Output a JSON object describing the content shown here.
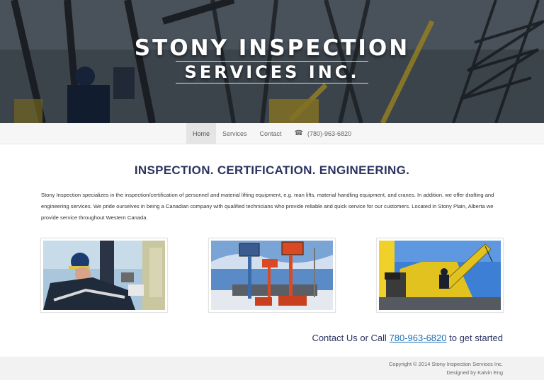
{
  "hero": {
    "title_line1": "STONY INSPECTION",
    "title_line2": "SERVICES INC."
  },
  "nav": {
    "items": [
      {
        "label": "Home",
        "active": true
      },
      {
        "label": "Services",
        "active": false
      },
      {
        "label": "Contact",
        "active": false
      }
    ],
    "phone_icon": "phone-icon",
    "phone": "(780)-963-6820"
  },
  "main": {
    "headline": "INSPECTION. CERTIFICATION. ENGINEERING.",
    "intro": "Stony Inspection specializes in the inspection/certification of personnel and material lifting equipment, e.g. man lifts, material handling equipment, and cranes. In addition, we offer drafting and engineering services. We pride ourselves in being a Canadian company with qualified technicians who provide reliable and quick service for our customers. Located in Stony Plain, Alberta we provide service throughout Western Canada.",
    "photos": [
      "technician-photo",
      "boom-lifts-photo",
      "crane-photo"
    ]
  },
  "cta": {
    "prefix": "Contact Us or Call ",
    "phone": "780-963-6820",
    "suffix": " to get started"
  },
  "footer": {
    "copyright": "Copyright © 2014 Stony Inspection Services Inc.",
    "credit": "Designed by Kalvin Eng"
  },
  "colors": {
    "headline": "#2c3360",
    "link": "#1f6fb5",
    "nav_bg": "#f6f6f6",
    "footer_bg": "#f2f2f2"
  }
}
